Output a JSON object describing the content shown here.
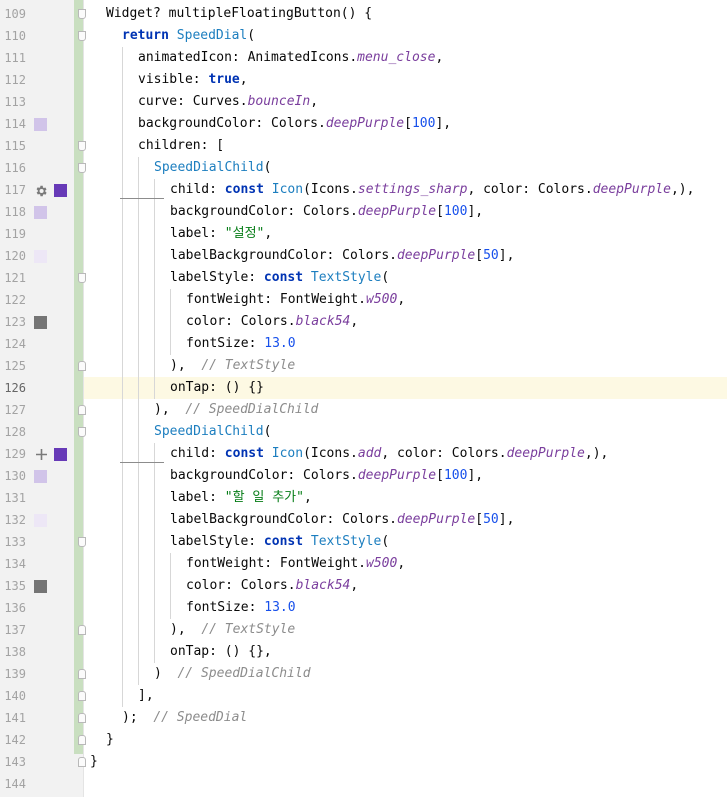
{
  "editor": {
    "current_line": 126,
    "lines": [
      {
        "n": 109,
        "indent": 1,
        "tokens": [
          [
            "p",
            "Widget? multipleFloatingButton() {"
          ]
        ]
      },
      {
        "n": 110,
        "indent": 2,
        "tokens": [
          [
            "kw",
            "return"
          ],
          [
            "p",
            " "
          ],
          [
            "cls",
            "SpeedDial"
          ],
          [
            "p",
            "("
          ]
        ]
      },
      {
        "n": 111,
        "indent": 3,
        "tokens": [
          [
            "p",
            "animatedIcon: AnimatedIcons."
          ],
          [
            "ital",
            "menu_close"
          ],
          [
            "p",
            ","
          ]
        ]
      },
      {
        "n": 112,
        "indent": 3,
        "tokens": [
          [
            "p",
            "visible: "
          ],
          [
            "kw",
            "true"
          ],
          [
            "p",
            ","
          ]
        ]
      },
      {
        "n": 113,
        "indent": 3,
        "tokens": [
          [
            "p",
            "curve: Curves."
          ],
          [
            "ital",
            "bounceIn"
          ],
          [
            "p",
            ","
          ]
        ]
      },
      {
        "n": 114,
        "indent": 3,
        "tokens": [
          [
            "p",
            "backgroundColor: Colors."
          ],
          [
            "ital",
            "deepPurple"
          ],
          [
            "p",
            "["
          ],
          [
            "num",
            "100"
          ],
          [
            "p",
            "],"
          ]
        ]
      },
      {
        "n": 115,
        "indent": 3,
        "tokens": [
          [
            "p",
            "children: ["
          ]
        ]
      },
      {
        "n": 116,
        "indent": 4,
        "tokens": [
          [
            "cls",
            "SpeedDialChild"
          ],
          [
            "p",
            "("
          ]
        ]
      },
      {
        "n": 117,
        "indent": 5,
        "tokens": [
          [
            "p",
            "child: "
          ],
          [
            "kw",
            "const"
          ],
          [
            "p",
            " "
          ],
          [
            "cls",
            "Icon"
          ],
          [
            "p",
            "(Icons."
          ],
          [
            "ital",
            "settings_sharp"
          ],
          [
            "p",
            ", color: Colors."
          ],
          [
            "ital",
            "deepPurple"
          ],
          [
            "p",
            ",),"
          ]
        ]
      },
      {
        "n": 118,
        "indent": 5,
        "tokens": [
          [
            "p",
            "backgroundColor: Colors."
          ],
          [
            "ital",
            "deepPurple"
          ],
          [
            "p",
            "["
          ],
          [
            "num",
            "100"
          ],
          [
            "p",
            "],"
          ]
        ]
      },
      {
        "n": 119,
        "indent": 5,
        "tokens": [
          [
            "p",
            "label: "
          ],
          [
            "str",
            "\"설정\""
          ],
          [
            "p",
            ","
          ]
        ]
      },
      {
        "n": 120,
        "indent": 5,
        "tokens": [
          [
            "p",
            "labelBackgroundColor: Colors."
          ],
          [
            "ital",
            "deepPurple"
          ],
          [
            "p",
            "["
          ],
          [
            "num",
            "50"
          ],
          [
            "p",
            "],"
          ]
        ]
      },
      {
        "n": 121,
        "indent": 5,
        "tokens": [
          [
            "p",
            "labelStyle: "
          ],
          [
            "kw",
            "const"
          ],
          [
            "p",
            " "
          ],
          [
            "cls",
            "TextStyle"
          ],
          [
            "p",
            "("
          ]
        ]
      },
      {
        "n": 122,
        "indent": 6,
        "tokens": [
          [
            "p",
            "fontWeight: FontWeight."
          ],
          [
            "ital",
            "w500"
          ],
          [
            "p",
            ","
          ]
        ]
      },
      {
        "n": 123,
        "indent": 6,
        "tokens": [
          [
            "p",
            "color: Colors."
          ],
          [
            "ital",
            "black54"
          ],
          [
            "p",
            ","
          ]
        ]
      },
      {
        "n": 124,
        "indent": 6,
        "tokens": [
          [
            "p",
            "fontSize: "
          ],
          [
            "num",
            "13.0"
          ]
        ]
      },
      {
        "n": 125,
        "indent": 5,
        "tokens": [
          [
            "p",
            "),  "
          ],
          [
            "cmt",
            "// TextStyle"
          ]
        ]
      },
      {
        "n": 126,
        "indent": 5,
        "tokens": [
          [
            "p",
            "onTap: () {}"
          ]
        ]
      },
      {
        "n": 127,
        "indent": 4,
        "tokens": [
          [
            "p",
            "),  "
          ],
          [
            "cmt",
            "// SpeedDialChild"
          ]
        ]
      },
      {
        "n": 128,
        "indent": 4,
        "tokens": [
          [
            "cls",
            "SpeedDialChild"
          ],
          [
            "p",
            "("
          ]
        ]
      },
      {
        "n": 129,
        "indent": 5,
        "tokens": [
          [
            "p",
            "child: "
          ],
          [
            "kw",
            "const"
          ],
          [
            "p",
            " "
          ],
          [
            "cls",
            "Icon"
          ],
          [
            "p",
            "(Icons."
          ],
          [
            "ital",
            "add"
          ],
          [
            "p",
            ", color: Colors."
          ],
          [
            "ital",
            "deepPurple"
          ],
          [
            "p",
            ",),"
          ]
        ]
      },
      {
        "n": 130,
        "indent": 5,
        "tokens": [
          [
            "p",
            "backgroundColor: Colors."
          ],
          [
            "ital",
            "deepPurple"
          ],
          [
            "p",
            "["
          ],
          [
            "num",
            "100"
          ],
          [
            "p",
            "],"
          ]
        ]
      },
      {
        "n": 131,
        "indent": 5,
        "tokens": [
          [
            "p",
            "label: "
          ],
          [
            "str",
            "\"할 일 추가\""
          ],
          [
            "p",
            ","
          ]
        ]
      },
      {
        "n": 132,
        "indent": 5,
        "tokens": [
          [
            "p",
            "labelBackgroundColor: Colors."
          ],
          [
            "ital",
            "deepPurple"
          ],
          [
            "p",
            "["
          ],
          [
            "num",
            "50"
          ],
          [
            "p",
            "],"
          ]
        ]
      },
      {
        "n": 133,
        "indent": 5,
        "tokens": [
          [
            "p",
            "labelStyle: "
          ],
          [
            "kw",
            "const"
          ],
          [
            "p",
            " "
          ],
          [
            "cls",
            "TextStyle"
          ],
          [
            "p",
            "("
          ]
        ]
      },
      {
        "n": 134,
        "indent": 6,
        "tokens": [
          [
            "p",
            "fontWeight: FontWeight."
          ],
          [
            "ital",
            "w500"
          ],
          [
            "p",
            ","
          ]
        ]
      },
      {
        "n": 135,
        "indent": 6,
        "tokens": [
          [
            "p",
            "color: Colors."
          ],
          [
            "ital",
            "black54"
          ],
          [
            "p",
            ","
          ]
        ]
      },
      {
        "n": 136,
        "indent": 6,
        "tokens": [
          [
            "p",
            "fontSize: "
          ],
          [
            "num",
            "13.0"
          ]
        ]
      },
      {
        "n": 137,
        "indent": 5,
        "tokens": [
          [
            "p",
            "),  "
          ],
          [
            "cmt",
            "// TextStyle"
          ]
        ]
      },
      {
        "n": 138,
        "indent": 5,
        "tokens": [
          [
            "p",
            "onTap: () {},"
          ]
        ]
      },
      {
        "n": 139,
        "indent": 4,
        "tokens": [
          [
            "p",
            ")  "
          ],
          [
            "cmt",
            "// SpeedDialChild"
          ]
        ]
      },
      {
        "n": 140,
        "indent": 3,
        "tokens": [
          [
            "p",
            "],"
          ]
        ]
      },
      {
        "n": 141,
        "indent": 2,
        "tokens": [
          [
            "p",
            ");  "
          ],
          [
            "cmt",
            "// SpeedDial"
          ]
        ]
      },
      {
        "n": 142,
        "indent": 1,
        "tokens": [
          [
            "p",
            "}"
          ]
        ]
      },
      {
        "n": 143,
        "indent": 0,
        "tokens": [
          [
            "p",
            "}"
          ]
        ]
      },
      {
        "n": 144,
        "indent": 0,
        "tokens": []
      }
    ]
  },
  "gutter_icons": [
    {
      "line": 114,
      "name": "color-swatch-icon",
      "color": "#d1c4e9"
    },
    {
      "line": 117,
      "name": "gear-icon",
      "color": "#7a7a7a"
    },
    {
      "line": 117,
      "name": "color-swatch-icon",
      "color": "#673ab7"
    },
    {
      "line": 118,
      "name": "color-swatch-icon",
      "color": "#d1c4e9"
    },
    {
      "line": 120,
      "name": "color-swatch-icon",
      "color": "#ede7f6"
    },
    {
      "line": 123,
      "name": "color-swatch-icon",
      "color": "#757575"
    },
    {
      "line": 129,
      "name": "plus-icon",
      "color": "#7a7a7a"
    },
    {
      "line": 129,
      "name": "color-swatch-icon",
      "color": "#673ab7"
    },
    {
      "line": 130,
      "name": "color-swatch-icon",
      "color": "#d1c4e9"
    },
    {
      "line": 132,
      "name": "color-swatch-icon",
      "color": "#ede7f6"
    },
    {
      "line": 135,
      "name": "color-swatch-icon",
      "color": "#757575"
    }
  ],
  "fold_markers": [
    {
      "line": 109,
      "kind": "top"
    },
    {
      "line": 110,
      "kind": "top"
    },
    {
      "line": 115,
      "kind": "top"
    },
    {
      "line": 116,
      "kind": "top"
    },
    {
      "line": 121,
      "kind": "top"
    },
    {
      "line": 125,
      "kind": "bot"
    },
    {
      "line": 127,
      "kind": "bot"
    },
    {
      "line": 128,
      "kind": "top"
    },
    {
      "line": 133,
      "kind": "top"
    },
    {
      "line": 137,
      "kind": "bot"
    },
    {
      "line": 139,
      "kind": "bot"
    },
    {
      "line": 140,
      "kind": "bot"
    },
    {
      "line": 141,
      "kind": "bot"
    },
    {
      "line": 142,
      "kind": "bot"
    },
    {
      "line": 143,
      "kind": "bot"
    }
  ]
}
